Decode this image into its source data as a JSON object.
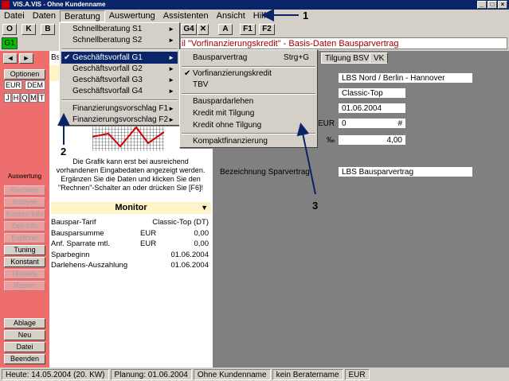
{
  "window": {
    "title": "VIS.A.VIS - Ohne Kundenname",
    "buttons": [
      "_",
      "□",
      "×"
    ]
  },
  "menubar": [
    "Datei",
    "Daten",
    "Beratung",
    "Auswertung",
    "Assistenten",
    "Ansicht",
    "Hilfe"
  ],
  "toolbar": [
    "O",
    "K",
    "B",
    "G4",
    "✕",
    "A",
    "F1",
    "F2"
  ],
  "g1_label": "G1",
  "headline": "il \"Vorfinanzierungskredit\" - Basis-Daten Bausparvertrag",
  "left": {
    "nav": [
      "◄",
      "►"
    ],
    "optionen": "Optionen",
    "currencies": [
      "EUR",
      "DEM"
    ],
    "periods": [
      "J",
      "H",
      "Q",
      "M",
      "T"
    ],
    "auswertung_label": "Auswertung",
    "auswertung_buttons": [
      "Rechnen",
      "Analyse",
      "Konten-Info",
      "Zeit-Info",
      "Explorer",
      "Tuning",
      "Konstant",
      "Hinweis",
      "Report"
    ],
    "bottom_buttons": [
      "Ablage",
      "Neu",
      "Datei",
      "Beenden"
    ]
  },
  "mid": {
    "tab_fragment": "Bs",
    "info_text": "Die Grafik kann erst bei ausreichend vorhandenen Eingabedaten angezeigt werden. Ergänzen Sie die Daten und klicken Sie den \"Rechnen\"-Schalter an oder drücken Sie [F6]!",
    "monitor_title": "Monitor",
    "monitor_rows": [
      {
        "label": "Bauspar-Tarif",
        "unit": "",
        "value": "Classic-Top  (DT)"
      },
      {
        "label": "Bausparsumme",
        "unit": "EUR",
        "value": "0,00"
      },
      {
        "label": "Anf. Sparrate mtl.",
        "unit": "EUR",
        "value": "0,00"
      },
      {
        "label": "Sparbeginn",
        "unit": "",
        "value": "01.06.2004"
      },
      {
        "label": "Darlehens-Auszahlung",
        "unit": "",
        "value": "01.06.2004"
      }
    ]
  },
  "right": {
    "tabs": [
      "Tilgung BSV",
      "VK"
    ],
    "fields": {
      "bausparkasse": "LBS Nord / Berlin - Hannover",
      "tarif": "Classic-Top",
      "datum": "01.06.2004",
      "eur_label": "EUR",
      "eur_value": "0",
      "eur_suffix": "#",
      "promille_label": "‰",
      "promille_value": "4,00",
      "bezeichnung_label": "Bezeichnung Sparvertrag",
      "bezeichnung_value": "LBS Bausparvertrag"
    }
  },
  "menu_beratung": [
    "Schnellberatung S1",
    "Schnellberatung S2",
    "Geschäftsvorfall G1",
    "Geschäftsvorfall G2",
    "Geschäftsvorfall G3",
    "Geschäftsvorfall G4",
    "Finanzierungsvorschlag F1",
    "Finanzierungsvorschlag F2"
  ],
  "menu_g1": {
    "items": [
      "Bausparvertrag",
      "Vorfinanzierungskredit",
      "TBV",
      "Bauspardarlehen",
      "Kredit mit Tilgung",
      "Kredit ohne Tilgung",
      "Kompaktfinanzierung"
    ],
    "shortcut": "Strg+G"
  },
  "annotations": [
    "1",
    "2",
    "3"
  ],
  "status": [
    "Heute: 14.05.2004 (20. KW)",
    "Planung: 01.06.2004",
    "Ohne Kundenname",
    "kein Beratername",
    "EUR"
  ]
}
